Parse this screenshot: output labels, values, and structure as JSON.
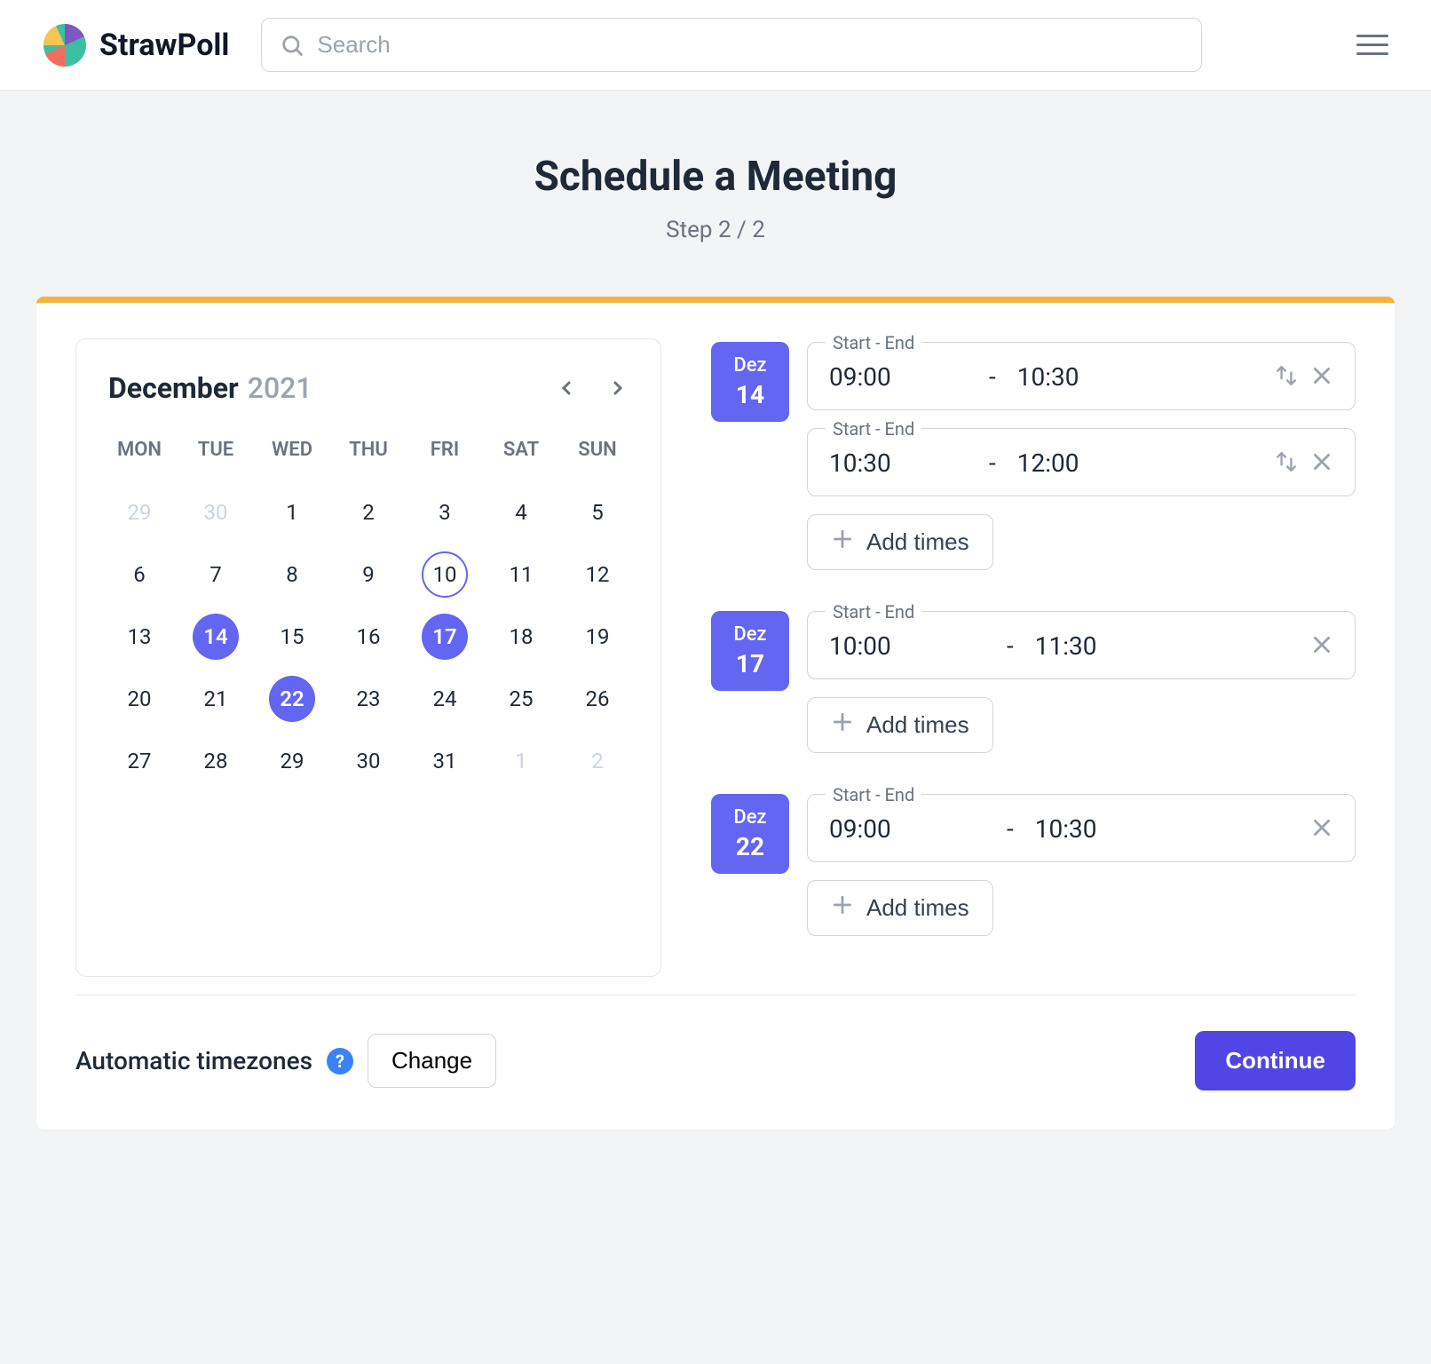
{
  "brand": {
    "name": "StrawPoll"
  },
  "search": {
    "placeholder": "Search"
  },
  "page": {
    "title": "Schedule a Meeting",
    "step_label": "Step 2 / 2"
  },
  "calendar": {
    "month": "December",
    "year": "2021",
    "dow": [
      "MON",
      "TUE",
      "WED",
      "THU",
      "FRI",
      "SAT",
      "SUN"
    ],
    "weeks": [
      [
        {
          "n": "29",
          "muted": true
        },
        {
          "n": "30",
          "muted": true
        },
        {
          "n": "1"
        },
        {
          "n": "2"
        },
        {
          "n": "3"
        },
        {
          "n": "4"
        },
        {
          "n": "5"
        }
      ],
      [
        {
          "n": "6"
        },
        {
          "n": "7"
        },
        {
          "n": "8"
        },
        {
          "n": "9"
        },
        {
          "n": "10",
          "today": true
        },
        {
          "n": "11"
        },
        {
          "n": "12"
        }
      ],
      [
        {
          "n": "13"
        },
        {
          "n": "14",
          "selected": true
        },
        {
          "n": "15"
        },
        {
          "n": "16"
        },
        {
          "n": "17",
          "selected": true
        },
        {
          "n": "18"
        },
        {
          "n": "19"
        }
      ],
      [
        {
          "n": "20"
        },
        {
          "n": "21"
        },
        {
          "n": "22",
          "selected": true
        },
        {
          "n": "23"
        },
        {
          "n": "24"
        },
        {
          "n": "25"
        },
        {
          "n": "26"
        }
      ],
      [
        {
          "n": "27"
        },
        {
          "n": "28"
        },
        {
          "n": "29"
        },
        {
          "n": "30"
        },
        {
          "n": "31"
        },
        {
          "n": "1",
          "muted": true
        },
        {
          "n": "2",
          "muted": true
        }
      ]
    ]
  },
  "slots": {
    "legend": "Start - End",
    "add_label": "Add times",
    "groups": [
      {
        "month": "Dez",
        "day": "14",
        "items": [
          {
            "start": "09:00",
            "end": "10:30",
            "reorder": true
          },
          {
            "start": "10:30",
            "end": "12:00",
            "reorder": true
          }
        ]
      },
      {
        "month": "Dez",
        "day": "17",
        "items": [
          {
            "start": "10:00",
            "end": "11:30",
            "reorder": false
          }
        ]
      },
      {
        "month": "Dez",
        "day": "22",
        "items": [
          {
            "start": "09:00",
            "end": "10:30",
            "reorder": false
          }
        ]
      }
    ]
  },
  "footer": {
    "tz_label": "Automatic timezones",
    "change": "Change",
    "continue": "Continue"
  }
}
